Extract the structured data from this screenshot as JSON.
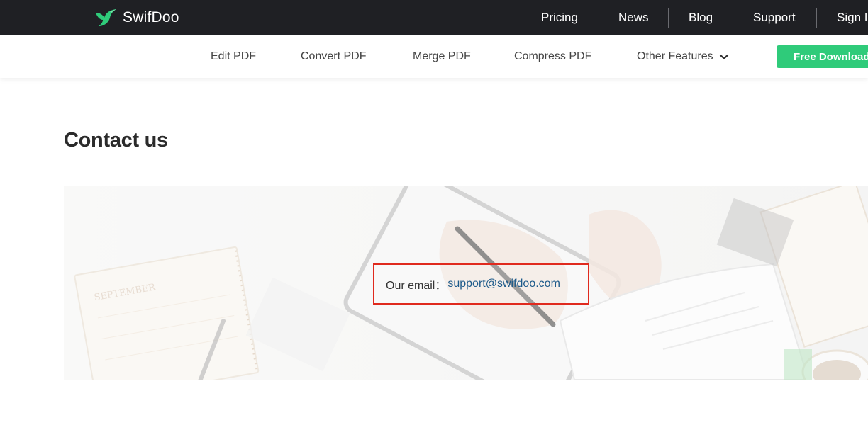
{
  "brand": {
    "name": "SwifDoo",
    "logo_icon": "swift-bird-icon",
    "accent": "#2fcb7a"
  },
  "topnav": {
    "items": [
      {
        "label": "Pricing"
      },
      {
        "label": "News"
      },
      {
        "label": "Blog"
      },
      {
        "label": "Support"
      },
      {
        "label": "Sign In"
      }
    ]
  },
  "subnav": {
    "items": [
      {
        "label": "Edit PDF"
      },
      {
        "label": "Convert PDF"
      },
      {
        "label": "Merge PDF"
      },
      {
        "label": "Compress PDF"
      },
      {
        "label": "Other Features",
        "icon": "chevron-down-icon"
      }
    ],
    "cta": "Free Download"
  },
  "main": {
    "title": "Contact us",
    "email_label": "Our email：",
    "email": "support@swifdoo.com",
    "highlight_color": "#e02a1e"
  }
}
